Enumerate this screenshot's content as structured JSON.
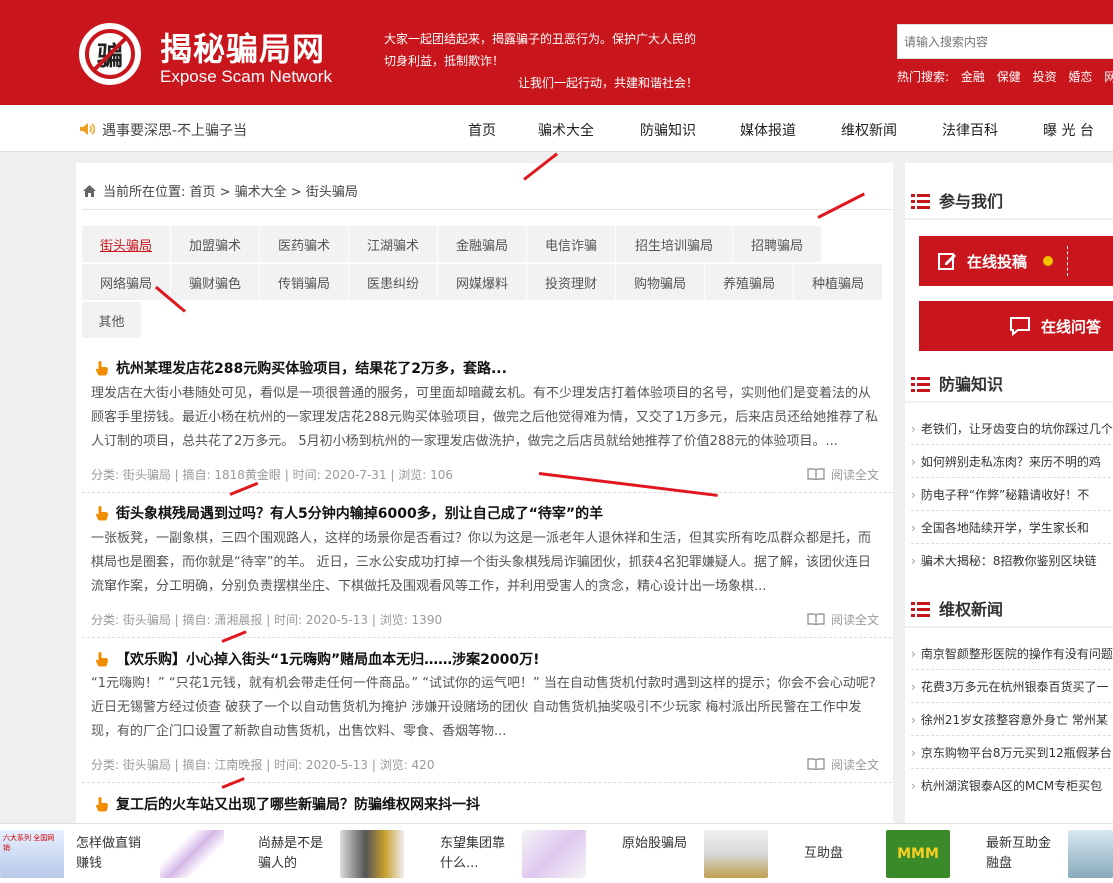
{
  "header": {
    "logo_char": "骗",
    "logo_cn": "揭秘骗局网",
    "logo_en": "Expose Scam Network",
    "slogan": [
      "大家一起团结起来，揭露骗子的丑恶行为。保护广大人民的",
      "切身利益，抵制欺诈！",
      "让我们一起行动，共建和谐社会！"
    ],
    "search_placeholder": "请输入搜索内容",
    "hot_label": "热门搜索:",
    "hot_items": [
      "金融",
      "保健",
      "投资",
      "婚恋",
      "网络"
    ]
  },
  "nav": {
    "notice": "遇事要深思-不上骗子当",
    "items": [
      "首页",
      "骗术大全",
      "防骗知识",
      "媒体报道",
      "维权新闻",
      "法律百科",
      "曝 光 台"
    ]
  },
  "breadcrumb": {
    "text": "当前所在位置: 首页 > 骗术大全 > 街头骗局"
  },
  "categories": [
    "街头骗局",
    "加盟骗术",
    "医药骗术",
    "江湖骗术",
    "金融骗局",
    "电信诈骗",
    "招生培训骗局",
    "招聘骗局",
    "网络骗局",
    "骗财骗色",
    "传销骗局",
    "医患纠纷",
    "网媒爆料",
    "投资理财",
    "购物骗局",
    "养殖骗局",
    "种植骗局",
    "其他"
  ],
  "posts": [
    {
      "title": "杭州某理发店花288元购买体验项目，结果花了2万多，套路...",
      "summary": "理发店在大街小巷随处可见，看似是一项很普通的服务，可里面却暗藏玄机。有不少理发店打着体验项目的名号，实则他们是变着法的从顾客手里捞钱。最近小杨在杭州的一家理发店花288元购买体验项目，做完之后他觉得难为情，又交了1万多元，后来店员还给她推荐了私人订制的项目，总共花了2万多元。 5月初小杨到杭州的一家理发店做洗护，做完之后店员就给她推荐了价值288元的体验项目。...",
      "meta": "分类: 街头骗局 | 摘自: 1818黄金眼 | 时间: 2020-7-31 | 浏览: 106",
      "read": "阅读全文"
    },
    {
      "title": "街头象棋残局遇到过吗？有人5分钟内输掉6000多，别让自己成了“待宰”的羊",
      "summary": "一张板凳，一副象棋，三四个围观路人，这样的场景你是否看过？你以为这是一派老年人退休祥和生活，但其实所有吃瓜群众都是托，而棋局也是圈套，而你就是“待宰”的羊。 近日，三水公安成功打掉一个街头象棋残局诈骗团伙，抓获4名犯罪嫌疑人。据了解，该团伙连日流窜作案，分工明确，分别负责摆棋坐庄、下棋做托及围观看风等工作，并利用受害人的贪念，精心设计出一场象棋...",
      "meta": "分类: 街头骗局 | 摘自: 潇湘晨报 | 时间: 2020-5-13 | 浏览: 1390",
      "read": "阅读全文"
    },
    {
      "title": "【欢乐购】小心掉入街头“1元嗨购”赌局血本无归……涉案2000万!",
      "summary": "“1元嗨购！” “只花1元钱，就有机会带走任何一件商品。” “试试你的运气吧！” 当在自动售货机付款时遇到这样的提示；你会不会心动呢? 近日无锡警方经过侦查 破获了一个以自动售货机为掩护 涉嫌开设赌场的团伙 自动售货机抽奖吸引不少玩家 梅村派出所民警在工作中发现，有的厂企门口设置了新款自动售货机，出售饮料、零食、香烟等物...",
      "meta": "分类: 街头骗局 | 摘自: 江南晚报 | 时间: 2020-5-13 | 浏览: 420",
      "read": "阅读全文"
    },
    {
      "title": "复工后的火车站又出现了哪些新骗局？防骗维权网来抖一抖"
    }
  ],
  "sidebar": {
    "join_title": "参与我们",
    "btn_submit": "在线投稿",
    "btn_ask": "在线问答",
    "knowledge_title": "防骗知识",
    "knowledge": [
      "老铁们，让牙齿变白的坑你踩过几个",
      "如何辨别走私冻肉？来历不明的鸡",
      "防电子秤“作弊”秘籍请收好！不",
      "全国各地陆续开学，学生家长和",
      "骗术大揭秘：8招教你鉴别区块链"
    ],
    "news_title": "维权新闻",
    "news": [
      "南京智颜整形医院的操作有没有问题",
      "花费3万多元在杭州银泰百货买了一",
      "徐州21岁女孩整容意外身亡 常州某",
      "京东购物平台8万元买到12瓶假茅台",
      "杭州湖滨银泰A区的MCM专柜买包"
    ]
  },
  "bottom_bar": [
    {
      "text": "怎样做直销赚钱",
      "img_label": "六大系列 全国网销"
    },
    {
      "text": "尚赫是不是骗人的"
    },
    {
      "text": "东望集团靠什么..."
    },
    {
      "text": "原始股骗局"
    },
    {
      "text": "互助盘"
    },
    {
      "text": "最新互助金融盘",
      "img_label": "MMM"
    }
  ],
  "colors": {
    "brand": "#c9161c",
    "arrow": "#e0171e"
  }
}
